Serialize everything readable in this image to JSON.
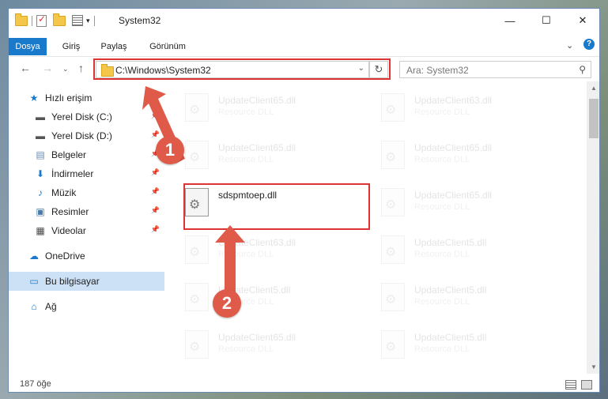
{
  "window": {
    "title": "System32"
  },
  "ribbon": {
    "tabs": [
      "Dosya",
      "Giriş",
      "Paylaş",
      "Görünüm"
    ],
    "help": "?"
  },
  "address": {
    "path": "C:\\Windows\\System32"
  },
  "search": {
    "placeholder": "Ara: System32"
  },
  "sidebar": {
    "items": [
      {
        "label": "Hızlı erişim",
        "icon": "star-icon"
      },
      {
        "label": "Yerel Disk (C:)",
        "icon": "drive-icon"
      },
      {
        "label": "Yerel Disk (D:)",
        "icon": "drive-icon"
      },
      {
        "label": "Belgeler",
        "icon": "documents-icon"
      },
      {
        "label": "İndirmeler",
        "icon": "download-icon"
      },
      {
        "label": "Müzik",
        "icon": "music-icon"
      },
      {
        "label": "Resimler",
        "icon": "pictures-icon"
      },
      {
        "label": "Videolar",
        "icon": "video-icon"
      },
      {
        "label": "OneDrive",
        "icon": "cloud-icon"
      },
      {
        "label": "Bu bilgisayar",
        "icon": "computer-icon"
      },
      {
        "label": "Ağ",
        "icon": "network-icon"
      }
    ]
  },
  "files": {
    "left": [
      {
        "name": "UpdateClient65.dll",
        "type": "Resource DLL"
      },
      {
        "name": "UpdateClient65.dll",
        "type": "Resource DLL"
      },
      {
        "name": "sdspmtoep.dll",
        "type": ""
      },
      {
        "name": "UpdateClient63.dll",
        "type": "Resource DLL"
      },
      {
        "name": "UpdateClient5.dll",
        "type": "Resource DLL"
      },
      {
        "name": "UpdateClient65.dll",
        "type": "Resource DLL"
      }
    ],
    "right": [
      {
        "name": "UpdateClient63.dll",
        "type": "Resource DLL"
      },
      {
        "name": "UpdateClient65.dll",
        "type": "Resource DLL"
      },
      {
        "name": "UpdateClient65.dll",
        "type": "Resource DLL"
      },
      {
        "name": "UpdateClient5.dll",
        "type": "Resource DLL"
      },
      {
        "name": "UpdateClient5.dll",
        "type": "Resource DLL"
      },
      {
        "name": "UpdateClient5.dll",
        "type": "Resource DLL"
      }
    ]
  },
  "status": {
    "count": "187 öğe"
  },
  "annotations": {
    "step1": "1",
    "step2": "2",
    "color": "#e05a4a"
  }
}
